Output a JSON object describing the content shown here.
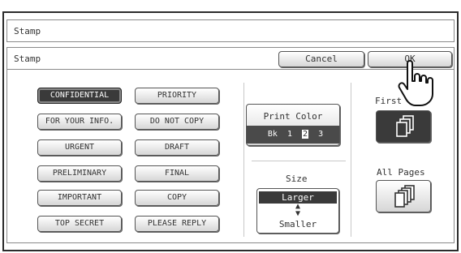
{
  "window": {
    "title": "Stamp"
  },
  "panel": {
    "title": "Stamp",
    "cancel_label": "Cancel",
    "ok_label": "OK"
  },
  "stamps": [
    {
      "label": "CONFIDENTIAL",
      "selected": true
    },
    {
      "label": "PRIORITY",
      "selected": false
    },
    {
      "label": "FOR YOUR INFO.",
      "selected": false
    },
    {
      "label": "DO NOT COPY",
      "selected": false
    },
    {
      "label": "URGENT",
      "selected": false
    },
    {
      "label": "DRAFT",
      "selected": false
    },
    {
      "label": "PRELIMINARY",
      "selected": false
    },
    {
      "label": "FINAL",
      "selected": false
    },
    {
      "label": "IMPORTANT",
      "selected": false
    },
    {
      "label": "COPY",
      "selected": false
    },
    {
      "label": "TOP SECRET",
      "selected": false
    },
    {
      "label": "PLEASE REPLY",
      "selected": false
    }
  ],
  "print_color": {
    "label": "Print Color",
    "options": [
      "Bk",
      "1",
      "2",
      "3"
    ],
    "selected": "2"
  },
  "size": {
    "label": "Size",
    "larger": "Larger",
    "smaller": "Smaller",
    "selected": "Larger"
  },
  "pages": {
    "first_label": "First",
    "all_label": "All Pages",
    "selected": "first",
    "icons": [
      "pages-stack-icon",
      "pages-stack-icon"
    ]
  },
  "cursor": {
    "icon": "pointing-hand-cursor-icon"
  }
}
